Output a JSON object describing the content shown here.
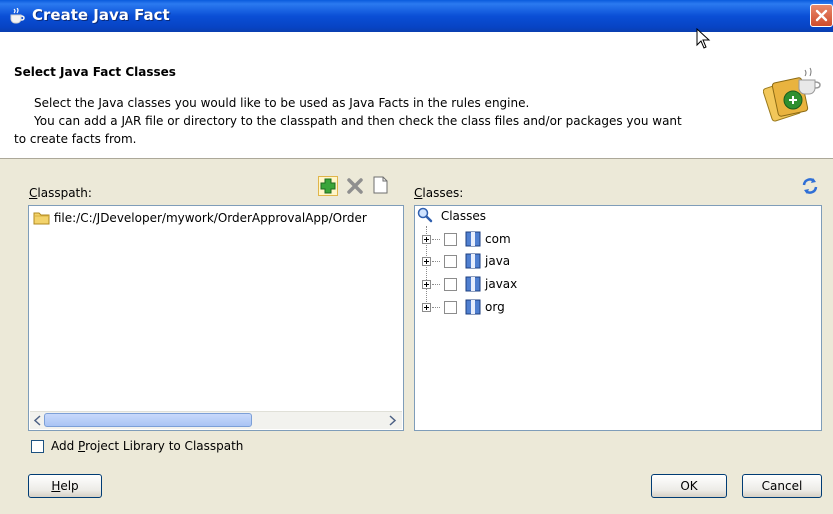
{
  "window": {
    "title": "Create Java Fact"
  },
  "header": {
    "title": "Select Java Fact Classes",
    "lines": [
      "Select the Java classes you would like to be used as Java Facts in the rules engine.",
      "You can add a JAR file or directory to the classpath and then check the class files and/or packages you want",
      "to create facts from."
    ]
  },
  "classpath": {
    "label_mnemonic": "C",
    "label_rest": "lasspath:",
    "items": [
      "file:/C:/JDeveloper/mywork/OrderApprovalApp/Order"
    ],
    "toolbar_icons": [
      "add-icon",
      "delete-icon",
      "new-file-icon"
    ]
  },
  "classes": {
    "label_mnemonic": "C",
    "label_rest": "lasses:",
    "root": "Classes",
    "packages": [
      "com",
      "java",
      "javax",
      "org"
    ],
    "refresh_icon": "refresh-icon"
  },
  "options": {
    "add_library_pre": "Add ",
    "add_library_mnemonic": "P",
    "add_library_post": "roject Library to Classpath",
    "add_library_checked": false
  },
  "buttons": {
    "help_mnemonic": "H",
    "help_rest": "elp",
    "ok": "OK",
    "cancel": "Cancel"
  },
  "colors": {
    "titlebar": "#0a4fd6",
    "dialog_bg": "#ece9d8",
    "listbox_border": "#7f9db9"
  }
}
